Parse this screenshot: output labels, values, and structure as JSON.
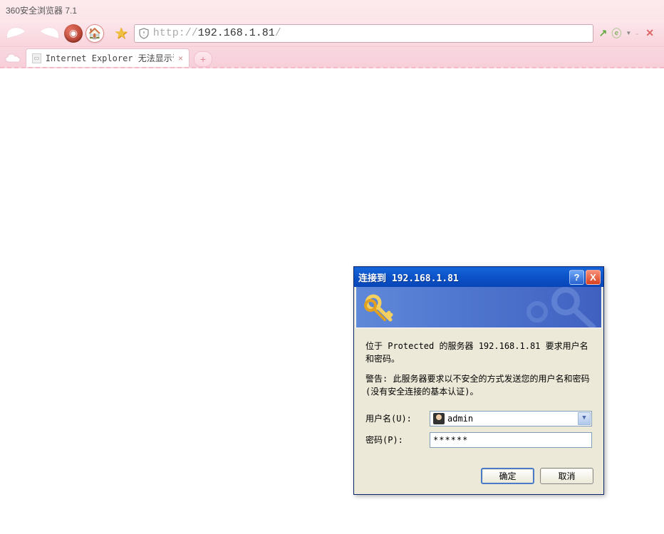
{
  "browser": {
    "title": "360安全浏览器 7.1",
    "url_prefix": "http://",
    "url_host": "192.168.1.81",
    "url_suffix": "/"
  },
  "tab": {
    "title": "Internet Explorer 无法显示该网",
    "close": "×"
  },
  "dialog": {
    "title": "连接到 192.168.1.81",
    "message1": "位于 Protected 的服务器 192.168.1.81 要求用户名和密码。",
    "message2": "警告: 此服务器要求以不安全的方式发送您的用户名和密码(没有安全连接的基本认证)。",
    "username_label": "用户名(U):",
    "username_value": "admin",
    "password_label": "密码(P):",
    "password_value": "******",
    "ok": "确定",
    "cancel": "取消"
  }
}
